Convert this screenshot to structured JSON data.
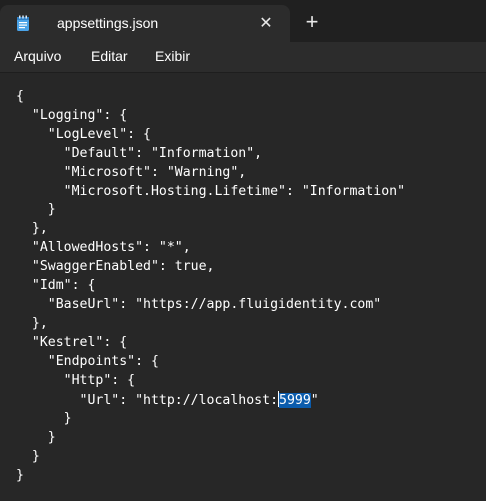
{
  "tab": {
    "title": "appsettings.json",
    "icon": "notepad-icon",
    "close_glyph": "✕",
    "new_tab_glyph": "+"
  },
  "menu": {
    "file": "Arquivo",
    "edit": "Editar",
    "view": "Exibir"
  },
  "editor": {
    "lines_before": [
      "{",
      "  \"Logging\": {",
      "    \"LogLevel\": {",
      "      \"Default\": \"Information\",",
      "      \"Microsoft\": \"Warning\",",
      "      \"Microsoft.Hosting.Lifetime\": \"Information\"",
      "    }",
      "  },",
      "  \"AllowedHosts\": \"*\",",
      "  \"SwaggerEnabled\": true,",
      "  \"Idm\": {",
      "    \"BaseUrl\": \"https://app.fluigidentity.com\"",
      "  },",
      "  \"Kestrel\": {",
      "    \"Endpoints\": {",
      "      \"Http\": {"
    ],
    "url_line_prefix": "        \"Url\": \"http://localhost:",
    "selected_text": "5999",
    "url_line_suffix": "\"",
    "lines_after": [
      "      }",
      "    }",
      "  }",
      "}"
    ]
  },
  "colors": {
    "background": "#272727",
    "titlebar": "#202020",
    "tab": "#2c2c2c",
    "selection": "#0b5cad"
  }
}
